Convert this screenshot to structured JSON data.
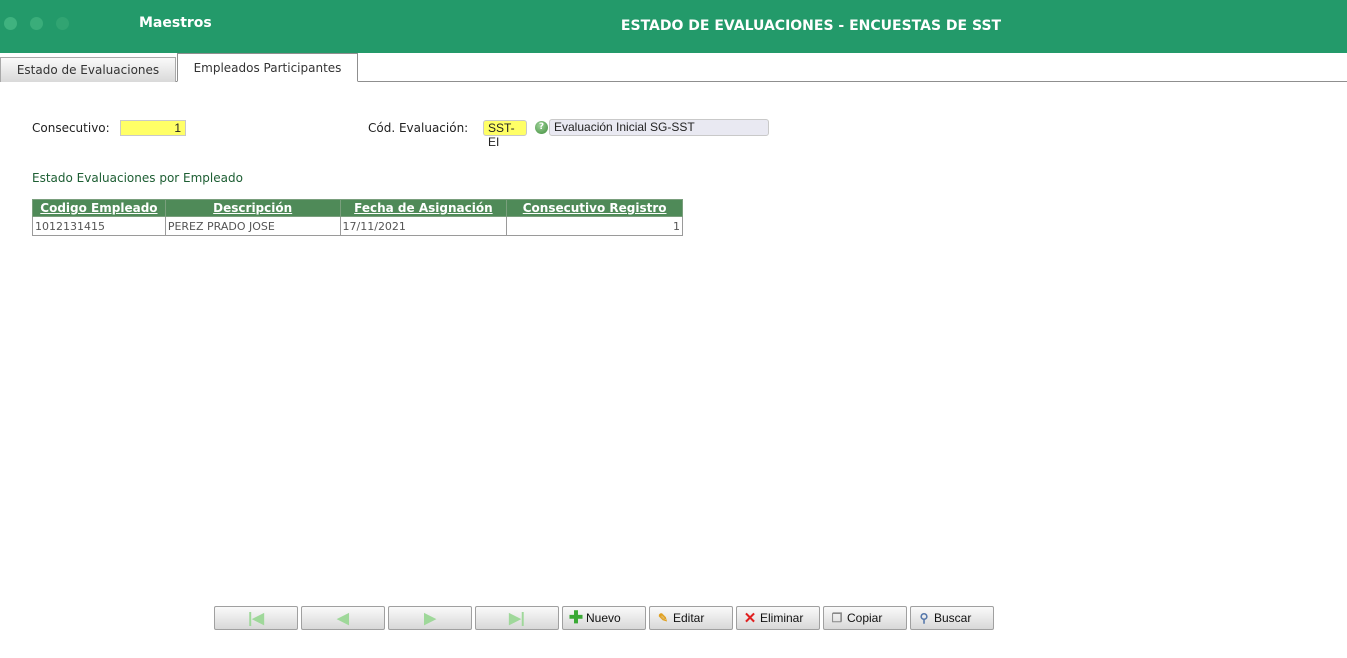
{
  "header": {
    "module": "Maestros",
    "title": "ESTADO DE EVALUACIONES - ENCUESTAS DE SST"
  },
  "tabs": [
    {
      "label": "Estado de Evaluaciones",
      "active": false
    },
    {
      "label": "Empleados Participantes",
      "active": true
    }
  ],
  "form": {
    "consecutivo_label": "Consecutivo:",
    "consecutivo_value": "1",
    "cod_evaluacion_label": "Cód. Evaluación:",
    "cod_evaluacion_value": "SST-EI",
    "descripcion_value": "Evaluación Inicial SG-SST"
  },
  "section": {
    "title": "Estado Evaluaciones por Empleado"
  },
  "table": {
    "columns": [
      "Codigo Empleado",
      "Descripción",
      "Fecha de Asignación",
      "Consecutivo Registro"
    ],
    "rows": [
      [
        "1012131415",
        "PEREZ PRADO JOSE",
        "17/11/2021",
        "1"
      ]
    ]
  },
  "toolbar": {
    "new_label": "Nuevo",
    "edit_label": "Editar",
    "delete_label": "Eliminar",
    "copy_label": "Copiar",
    "search_label": "Buscar"
  },
  "colors": {
    "header": "#239a6a",
    "table_header": "#4f8a58",
    "highlight": "#ffff66"
  }
}
